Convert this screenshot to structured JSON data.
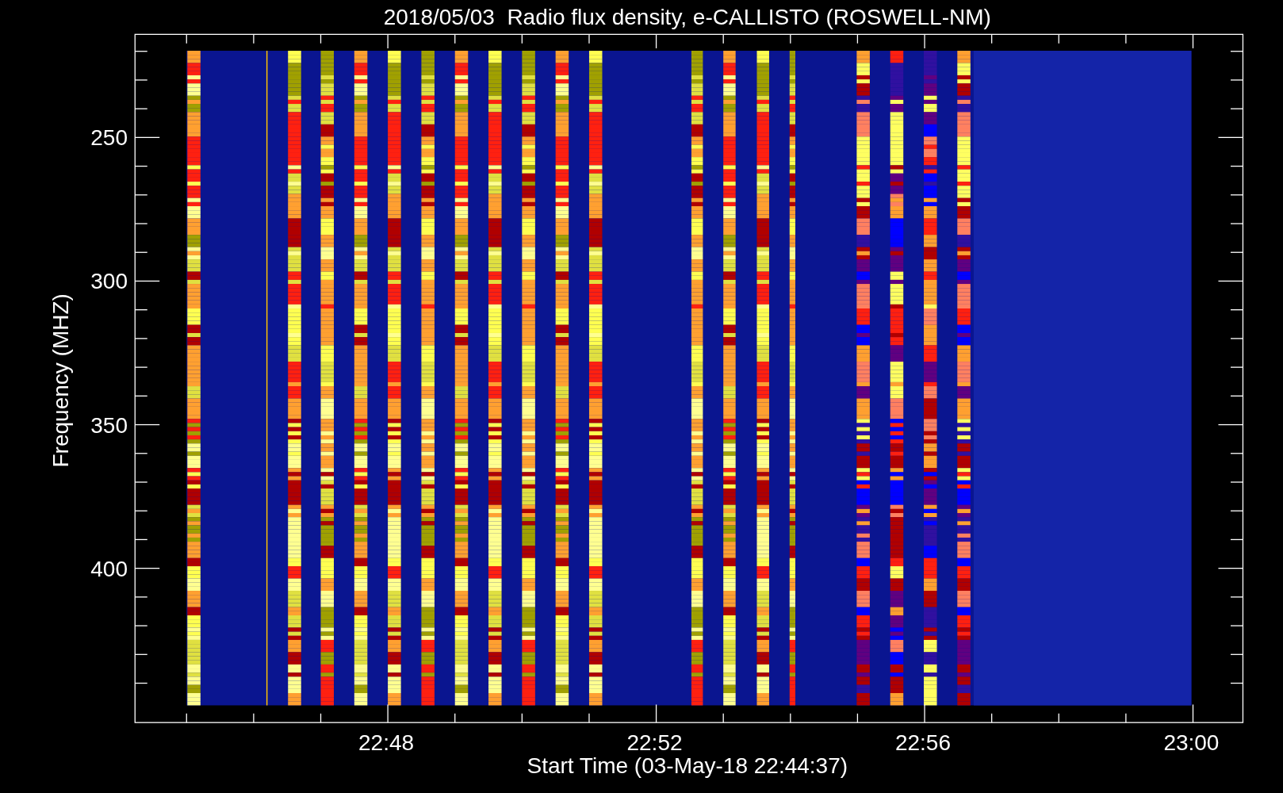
{
  "chart": {
    "title": "2018/05/03  Radio flux density, e-CALLISTO (ROSWELL-NM)",
    "ylabel": "Frequency (MHZ)",
    "xlabel": "Start Time (03-May-18 22:44:37)",
    "yticks": [
      "250",
      "300",
      "350",
      "400"
    ],
    "xticks": [
      "22:48",
      "22:52",
      "22:56",
      "23:00"
    ]
  }
}
